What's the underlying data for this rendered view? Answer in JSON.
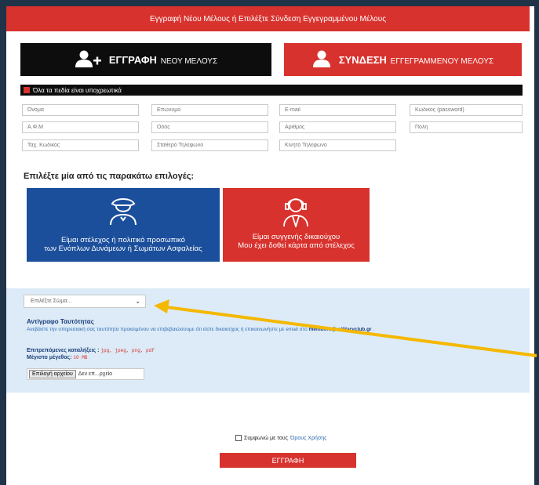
{
  "header": {
    "title": "Εγγραφή Νέου Μέλους ή Επιλέξτε Σύνδεση Εγγεγραμμένου Μέλους"
  },
  "tabs": {
    "register": {
      "bold": "ΕΓΓΡΑΦΗ",
      "rest": "ΝΕΟΥ ΜΕΛΟΥΣ"
    },
    "login": {
      "bold": "ΣΥΝΔΕΣΗ",
      "rest": "ΕΓΓΕΓΡΑΜΜΕΝΟΥ ΜΕΛΟΥΣ"
    }
  },
  "form": {
    "required_note": "Όλα τα πεδία είναι υποχρεωτικά",
    "placeholders": {
      "first_name": "Όνομα",
      "last_name": "Επώνυμο",
      "email": "E-mail",
      "password": "Κωδικός (password)",
      "afm": "Α.Φ.Μ",
      "street": "Οδός",
      "number": "Αριθμός",
      "city": "Πόλη",
      "postal": "Ταχ. Κωδικός",
      "landline": "Σταθερό Τηλέφωνο",
      "mobile": "Κινητό Τηλέφωνο"
    }
  },
  "options": {
    "title": "Επιλέξτε μία από τις παρακάτω επιλογές:",
    "personnel": {
      "line1": "Είμαι στέλεχος ή πολιτικό προσωπικό",
      "line2": "των Ενόπλων Δυνάμεων ή Σωμάτων Ασφαλείας"
    },
    "relative": {
      "line1": "Είμαι συγγενής δικαιούχου",
      "line2": "Μου έχει δοθεί κάρτα από στέλεχος"
    }
  },
  "upload": {
    "select_value": "Επιλέξτε Σώμα...",
    "id_title": "Αντίγραφο Ταυτότητας",
    "id_desc": "Ανεβάστε την υπηρεσιακή σας ταυτότητα προκειμένου να επιβεβαιώσουμε ότι είστε δικαιούχος ή επικοινωνήστε με email στο",
    "email": "members@militaryclub.gr",
    "ext_label": "Επιτρεπόμενες καταλήξεις :",
    "ext_values": "jpg, jpeg, png, pdf",
    "max_label": "Μέγιστο μέγεθος:",
    "max_value": "10 MB",
    "file_button": "Επιλογή αρχείου",
    "file_status": "Δεν επ...ρχείο"
  },
  "footer": {
    "agree_text": "Συμφωνώ με τους",
    "terms_link": "Όρους Χρήσης",
    "submit": "ΕΓΓΡΑΦΗ"
  },
  "colors": {
    "accent_red": "#d8322e",
    "dark": "#0d0d0d",
    "blue": "#1b4f9c",
    "arrow": "#f5b800"
  }
}
